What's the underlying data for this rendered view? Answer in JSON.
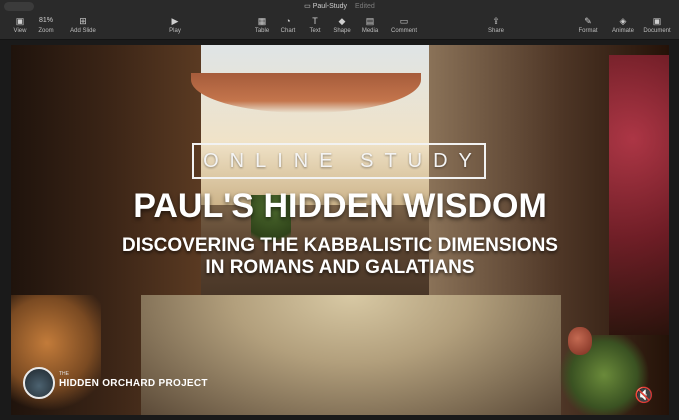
{
  "window": {
    "title": "Paul-Study",
    "status": "Edited"
  },
  "toolbar": {
    "items": [
      {
        "label": "View",
        "icon": "sidebar-icon"
      },
      {
        "label": "Zoom",
        "value": "81%",
        "icon": "zoom-select"
      },
      {
        "label": "Add Slide",
        "icon": "plus-square-icon"
      },
      {
        "label": "Play",
        "icon": "play-icon"
      },
      {
        "label": "Table",
        "icon": "table-icon"
      },
      {
        "label": "Chart",
        "icon": "chart-icon"
      },
      {
        "label": "Text",
        "icon": "text-icon"
      },
      {
        "label": "Shape",
        "icon": "shape-icon"
      },
      {
        "label": "Media",
        "icon": "media-icon"
      },
      {
        "label": "Comment",
        "icon": "comment-icon"
      },
      {
        "label": "Share",
        "icon": "share-icon"
      },
      {
        "label": "Format",
        "icon": "format-icon"
      },
      {
        "label": "Animate",
        "icon": "animate-icon"
      },
      {
        "label": "Document",
        "icon": "document-icon"
      }
    ]
  },
  "slide": {
    "badge": "ONLINE STUDY",
    "title": "PAUL'S HIDDEN WISDOM",
    "subtitle_line1": "DISCOVERING THE KABBALISTIC DIMENSIONS",
    "subtitle_line2": "IN ROMANS AND GALATIANS",
    "logo_small": "THE",
    "logo_name": "HIDDEN ORCHARD PROJECT"
  },
  "controls": {
    "mute_icon": "speaker-muted-icon"
  },
  "colors": {
    "toolbar_bg": "#2a2a2a",
    "text_white": "#ffffff"
  }
}
